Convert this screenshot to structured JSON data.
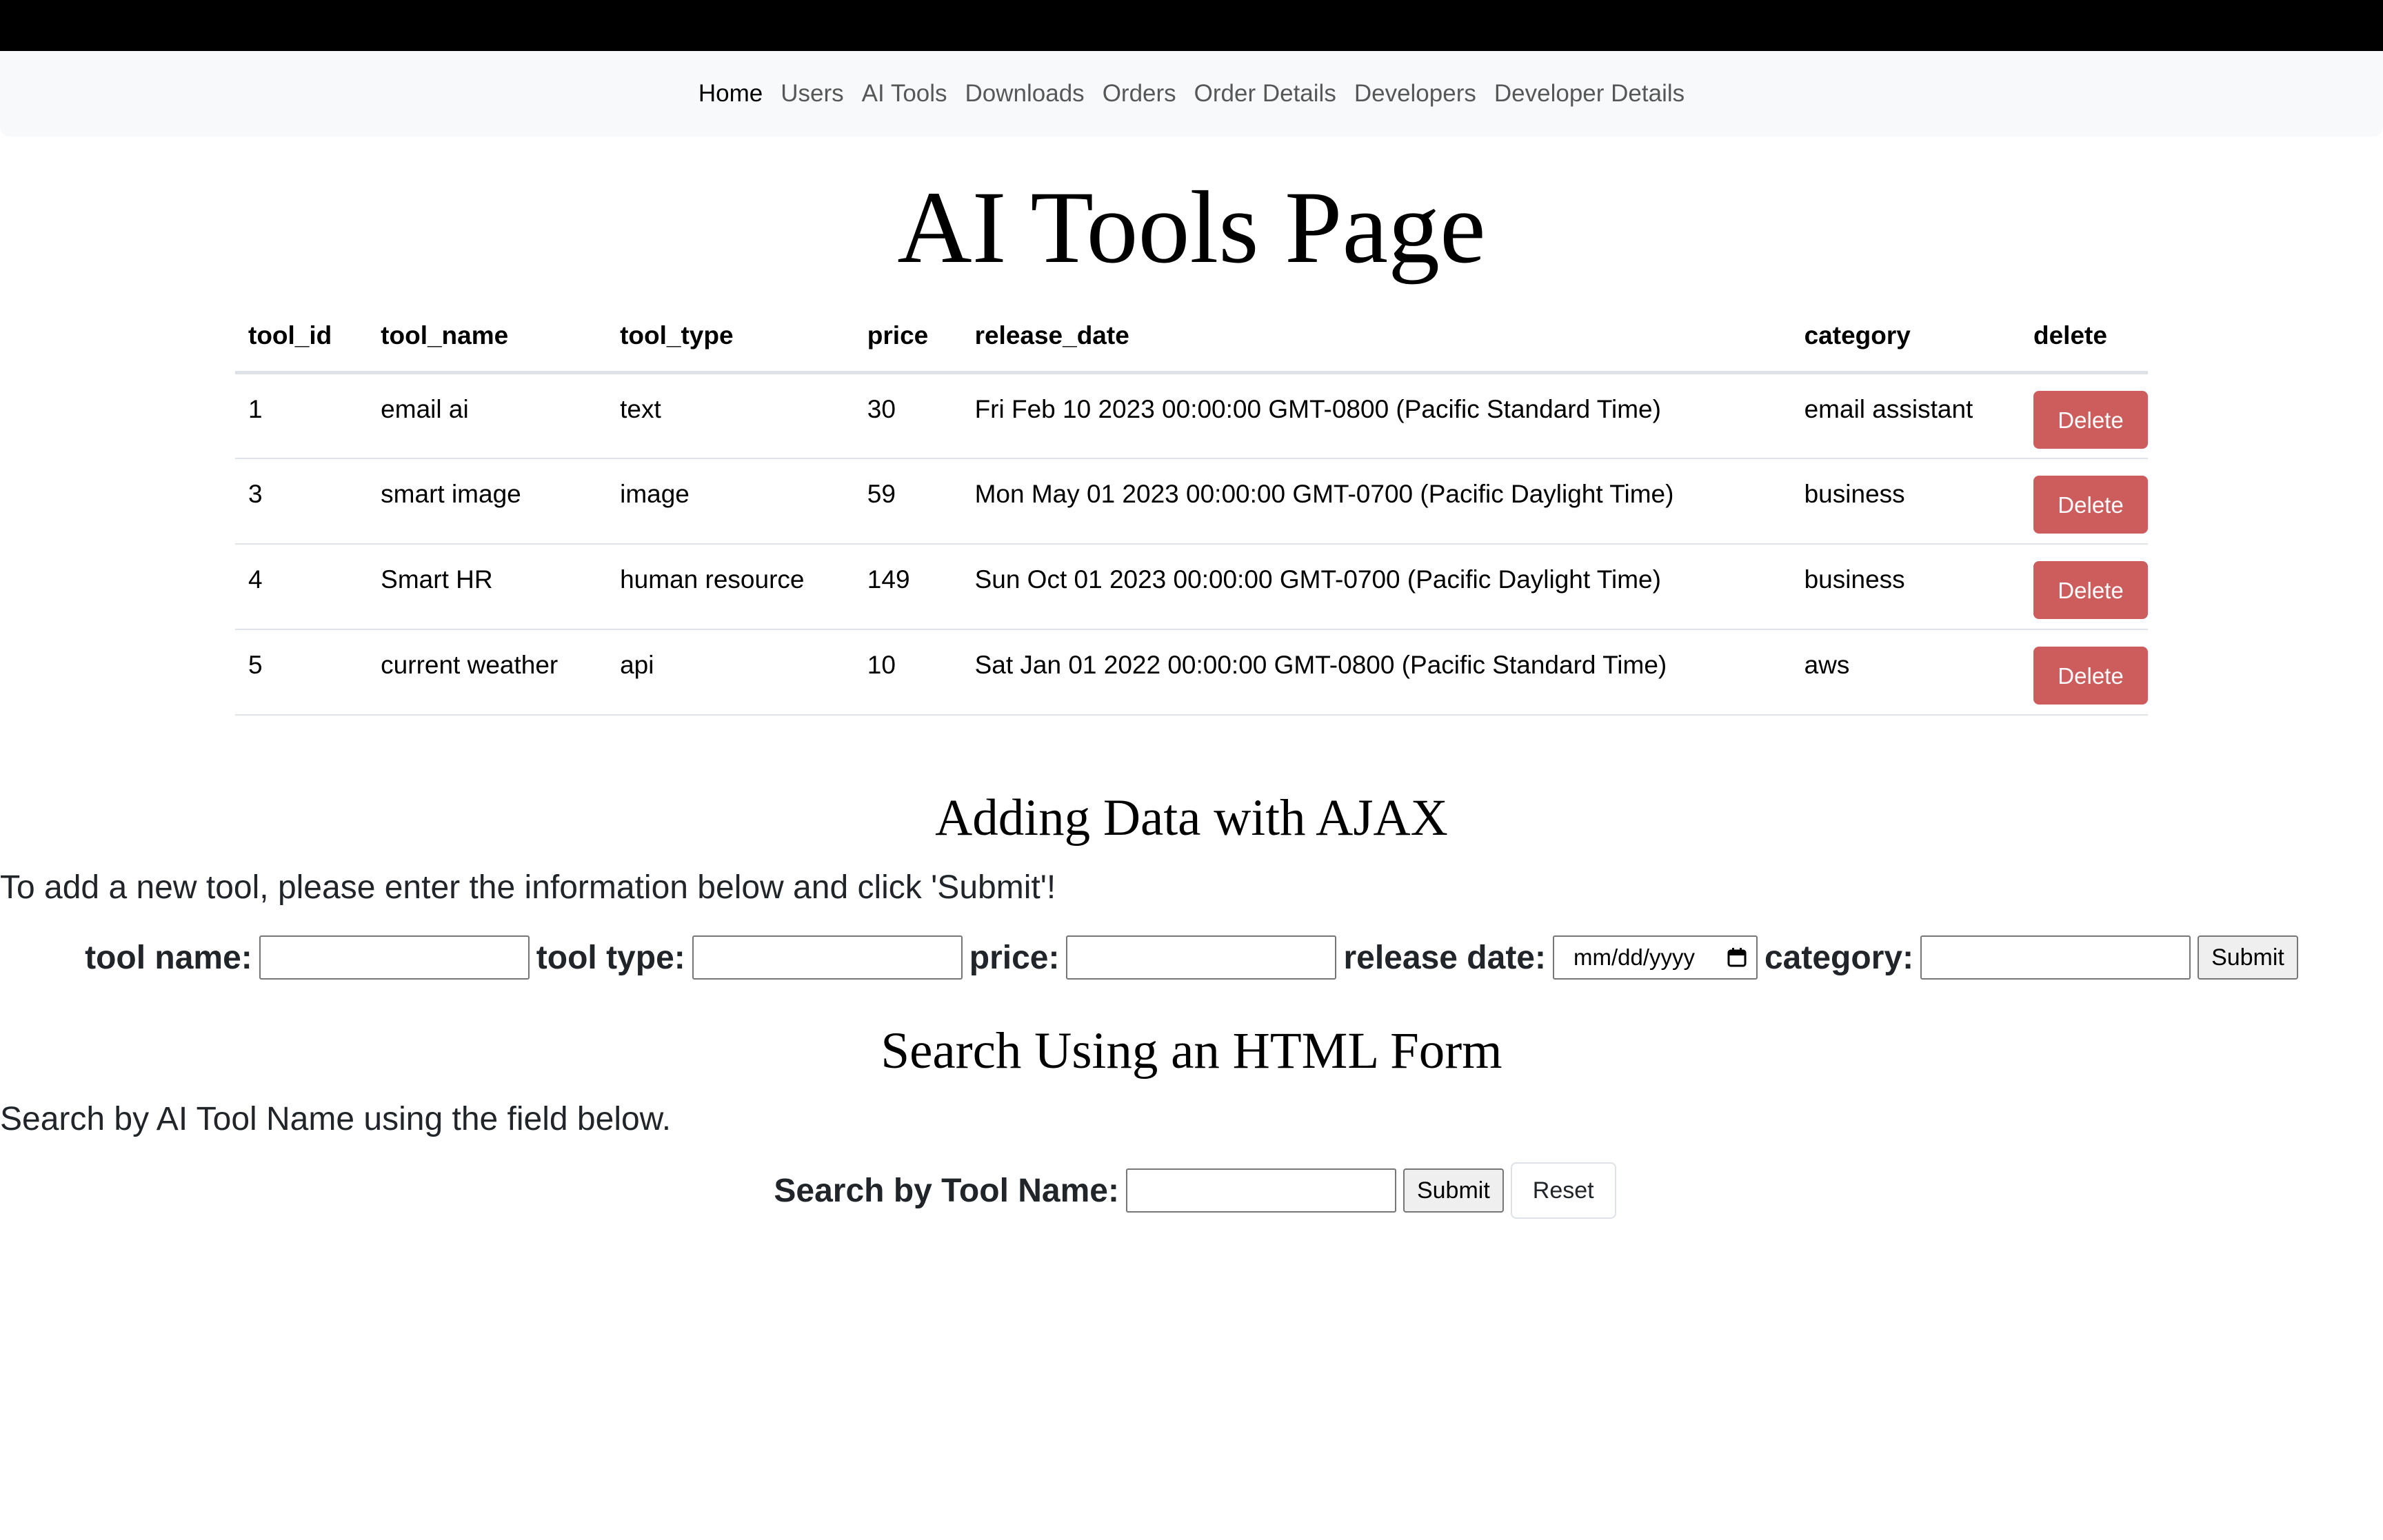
{
  "nav": {
    "items": [
      {
        "label": "Home",
        "active": true
      },
      {
        "label": "Users"
      },
      {
        "label": "AI Tools"
      },
      {
        "label": "Downloads"
      },
      {
        "label": "Orders"
      },
      {
        "label": "Order Details"
      },
      {
        "label": "Developers"
      },
      {
        "label": "Developer Details"
      }
    ]
  },
  "page": {
    "title": "AI Tools Page"
  },
  "table": {
    "headers": [
      "tool_id",
      "tool_name",
      "tool_type",
      "price",
      "release_date",
      "category",
      "delete"
    ],
    "rows": [
      [
        "1",
        "email ai",
        "text",
        "30",
        "Fri Feb 10 2023 00:00:00 GMT-0800 (Pacific Standard Time)",
        "email assistant",
        "Delete"
      ],
      [
        "3",
        "smart image",
        "image",
        "59",
        "Mon May 01 2023 00:00:00 GMT-0700 (Pacific Daylight Time)",
        "business",
        "Delete"
      ],
      [
        "4",
        "Smart HR",
        "human resource",
        "149",
        "Sun Oct 01 2023 00:00:00 GMT-0700 (Pacific Daylight Time)",
        "business",
        "Delete"
      ],
      [
        "5",
        "current weather",
        "api",
        "10",
        "Sat Jan 01 2022 00:00:00 GMT-0800 (Pacific Standard Time)",
        "aws",
        "Delete"
      ]
    ]
  },
  "add_form": {
    "heading": "Adding Data with AJAX",
    "intro": "To add a new tool, please enter the information below and click 'Submit'!",
    "tool_name_label": "tool name:",
    "tool_type_label": "tool type:",
    "price_label": "price:",
    "release_date_label": "release date:",
    "release_date_placeholder": "mm/dd/yyyy",
    "category_label": "category:",
    "submit_label": "Submit"
  },
  "search_form": {
    "heading": "Search Using an HTML Form",
    "intro": "Search by AI Tool Name using the field below.",
    "label": "Search by Tool Name:",
    "submit_label": "Submit",
    "reset_label": "Reset"
  },
  "colors": {
    "delete_button": "#cd5c5c",
    "navbar_bg": "#f8f9fa",
    "topbar_bg": "#000000"
  }
}
